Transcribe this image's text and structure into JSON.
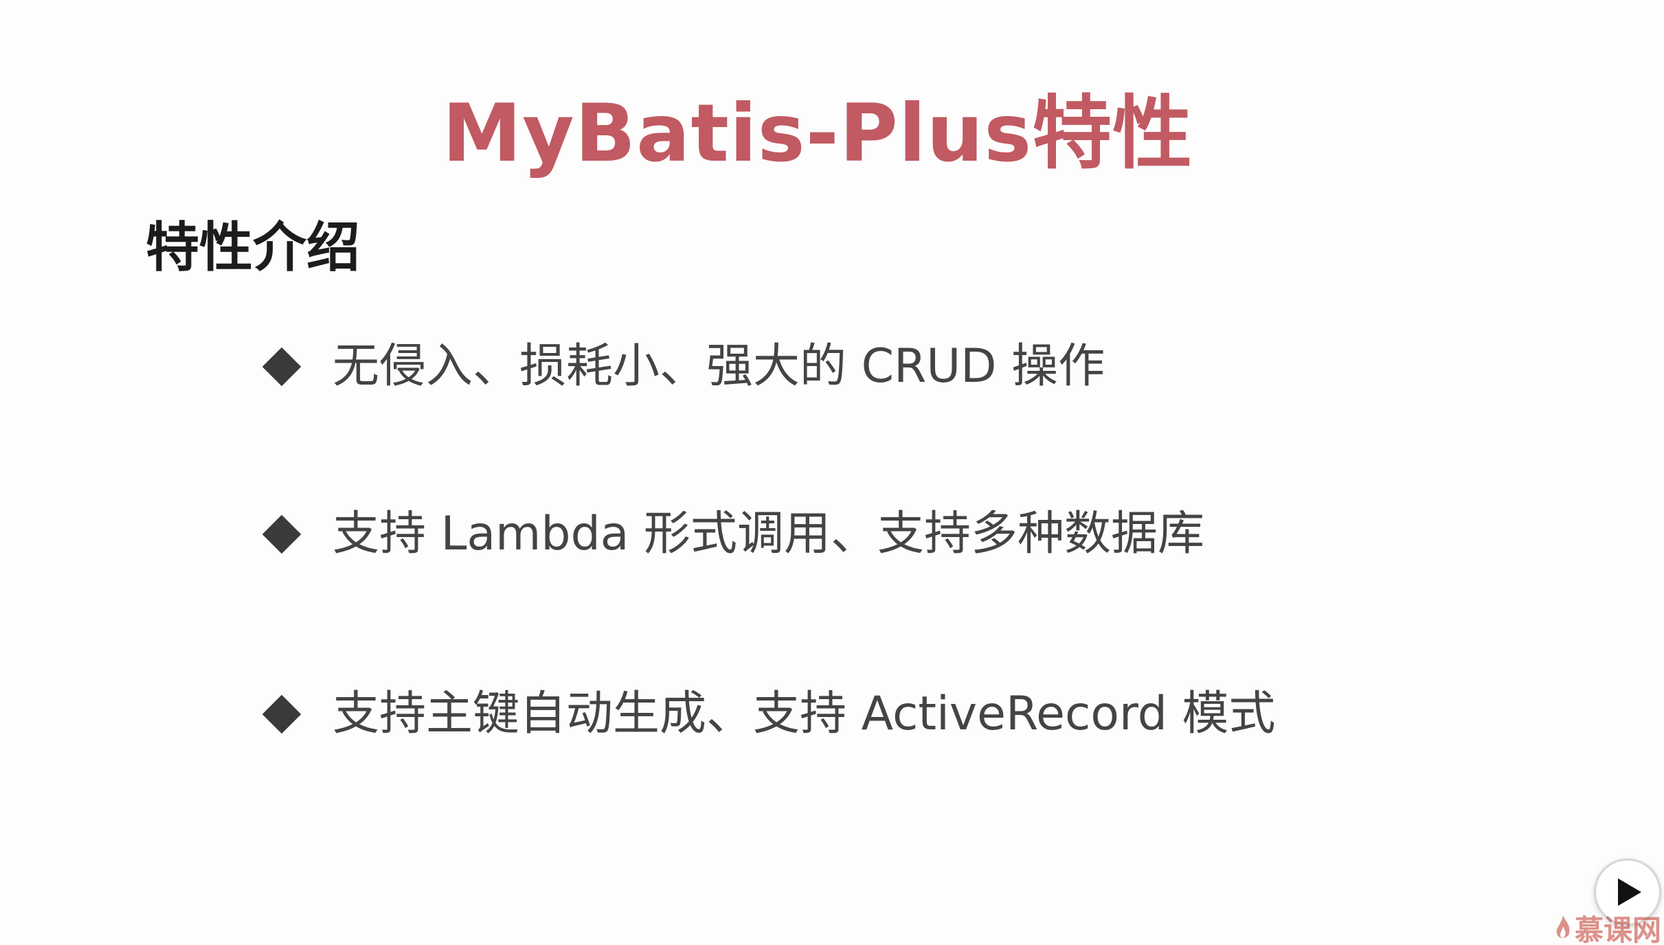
{
  "slide": {
    "title": "MyBatis-Plus特性",
    "section_heading": "特性介绍",
    "bullets": [
      "无侵入、损耗小、强大的 CRUD 操作",
      "支持 Lambda 形式调用、支持多种数据库",
      "支持主键自动生成、支持 ActiveRecord 模式"
    ]
  },
  "player": {
    "play_icon": "play-icon",
    "watermark_icon": "flame-icon",
    "watermark_text": "慕课网"
  },
  "colors": {
    "title": "#c15a62",
    "heading": "#1c1c1c",
    "bullet_text": "#444444",
    "bullet_marker": "#3a3a3a",
    "watermark": "#c0392b"
  }
}
